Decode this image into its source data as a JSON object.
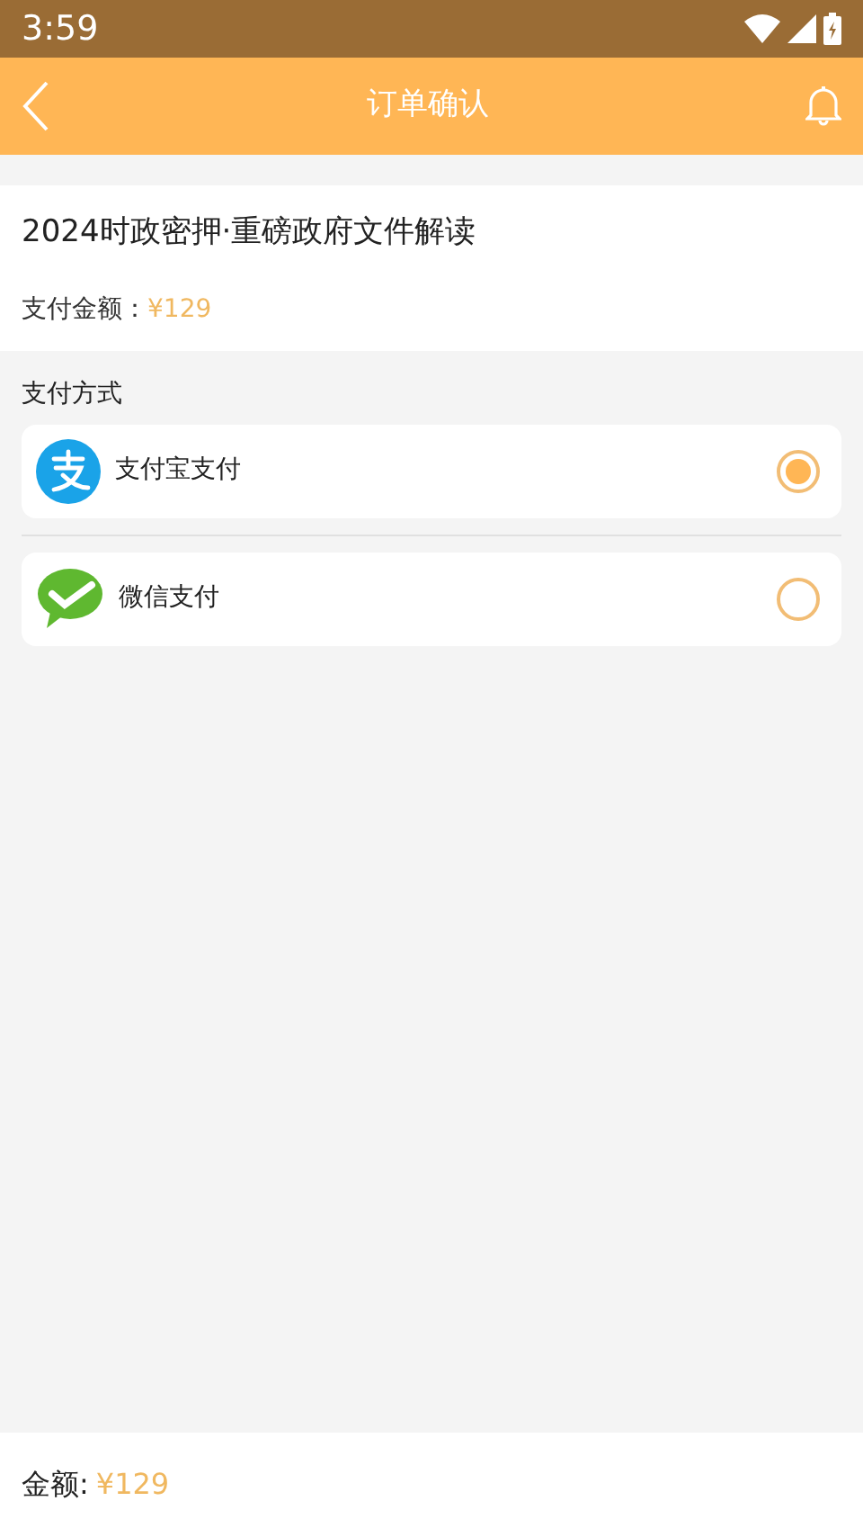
{
  "status_bar": {
    "time": "3:59"
  },
  "header": {
    "title": "订单确认"
  },
  "order": {
    "title": "2024时政密押·重磅政府文件解读",
    "amount_label": "支付金额：",
    "amount": "¥129"
  },
  "payment": {
    "heading": "支付方式",
    "methods": [
      {
        "kind": "alipay",
        "label": "支付宝支付",
        "selected": true
      },
      {
        "kind": "wechat",
        "label": "微信支付",
        "selected": false
      }
    ]
  },
  "footer": {
    "label": "金额:",
    "amount": "¥129"
  }
}
